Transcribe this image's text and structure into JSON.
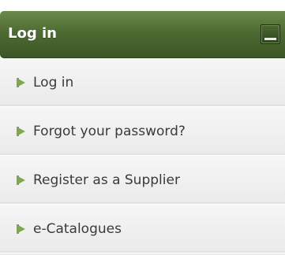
{
  "panel": {
    "title": "Log in",
    "collapse_icon": "minus-icon"
  },
  "menu": {
    "bullet_icon": "green-triangle-bullet-icon",
    "items": [
      {
        "label": "Log in"
      },
      {
        "label": "Forgot your password?"
      },
      {
        "label": "Register as a Supplier"
      },
      {
        "label": "e-Catalogues"
      }
    ]
  },
  "colors": {
    "header_green": "#4e6b33",
    "bullet_green": "#7ea84f",
    "item_background": "#eeeeee",
    "item_text": "#3a3a3a"
  }
}
